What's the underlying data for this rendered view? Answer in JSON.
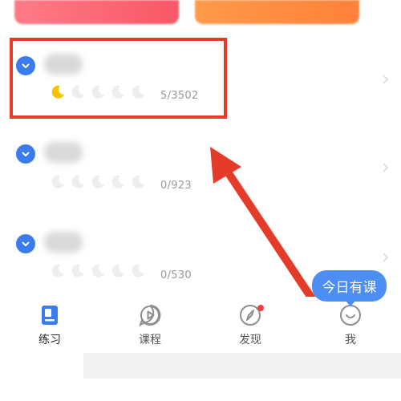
{
  "items": [
    {
      "progress": "5/3502",
      "earned_moons": 1,
      "total_moons": 5
    },
    {
      "progress": "0/923",
      "earned_moons": 0,
      "total_moons": 5
    },
    {
      "progress": "0/530",
      "earned_moons": 0,
      "total_moons": 5
    }
  ],
  "tooltip": {
    "text": "今日有课"
  },
  "tabs": [
    {
      "label": "练习",
      "icon": "practice-book-icon",
      "active": true
    },
    {
      "label": "课程",
      "icon": "course-play-icon",
      "active": false
    },
    {
      "label": "发现",
      "icon": "discover-compass-icon",
      "active": false,
      "badge": true
    },
    {
      "label": "我",
      "icon": "profile-smile-icon",
      "active": false
    }
  ],
  "colors": {
    "accent": "#3a7cf0",
    "highlight": "#e43c28",
    "moon_earned": "#f5c400",
    "moon_empty": "#eeeeee",
    "tooltip": "#4c8ef4",
    "badge": "#f23d3d"
  }
}
